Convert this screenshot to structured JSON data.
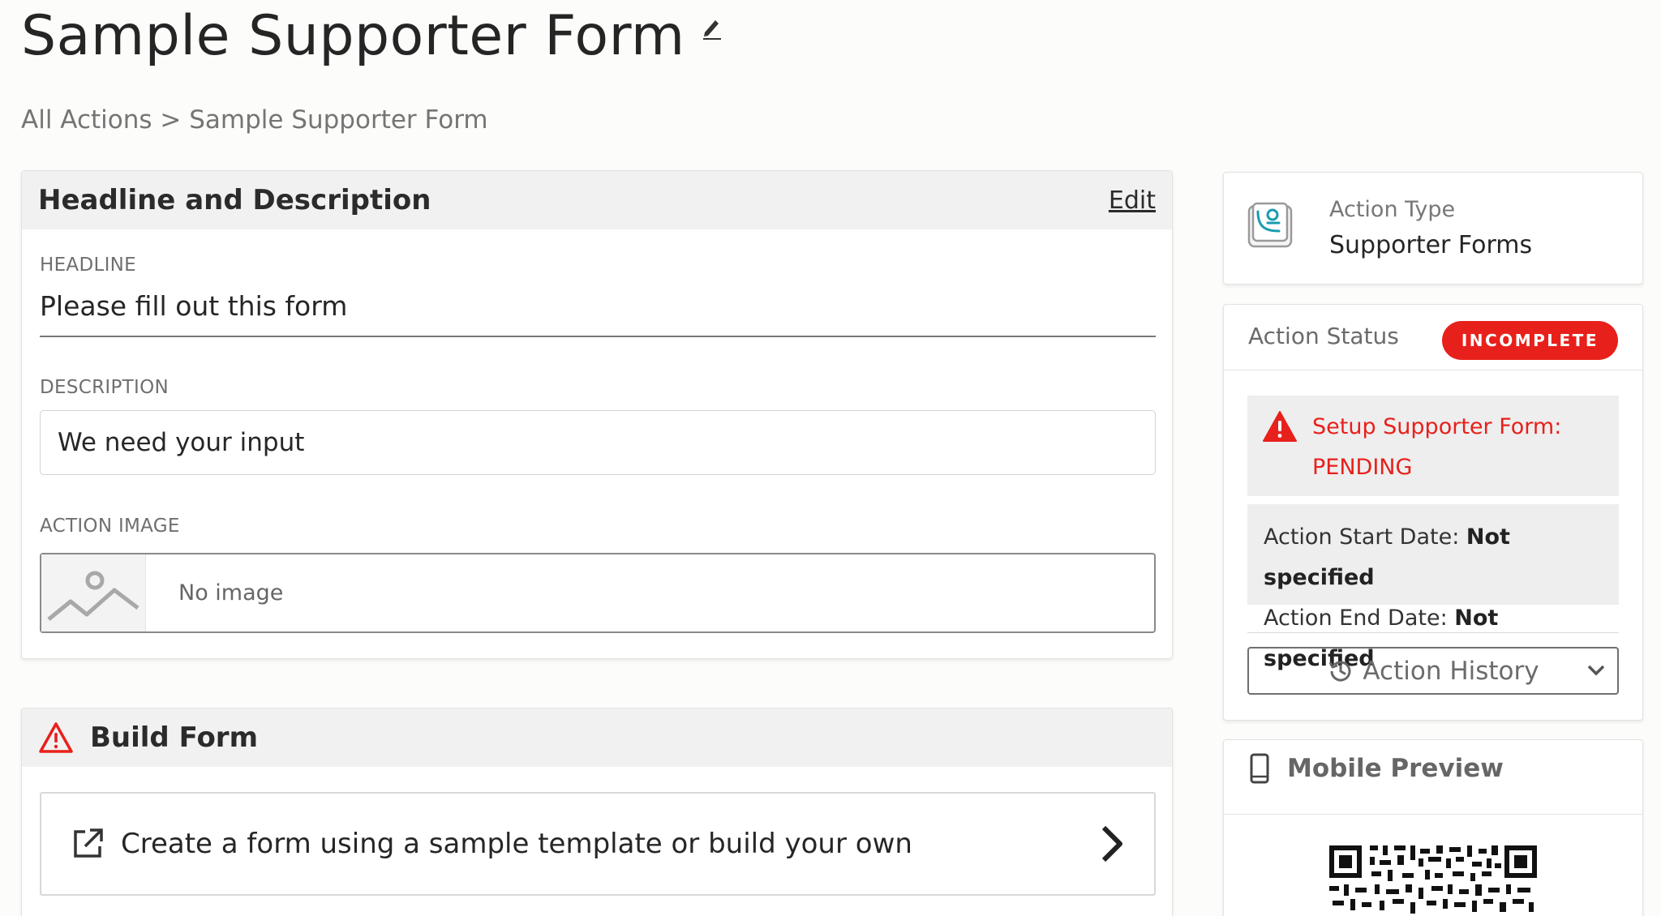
{
  "page": {
    "title": "Sample Supporter Form",
    "breadcrumb": "All Actions > Sample Supporter Form"
  },
  "headline_card": {
    "title": "Headline and Description",
    "edit_label": "Edit",
    "headline_label": "HEADLINE",
    "headline_value": "Please fill out this form",
    "description_label": "DESCRIPTION",
    "description_value": "We need your input",
    "image_label": "ACTION IMAGE",
    "image_placeholder": "No image"
  },
  "build_card": {
    "title": "Build Form",
    "item_label": "Create a form using a sample template or build your own"
  },
  "action_type": {
    "label": "Action Type",
    "value": "Supporter Forms",
    "icon": "supporter-form-icon"
  },
  "action_status": {
    "title": "Action Status",
    "badge": "INCOMPLETE",
    "pending_line1": "Setup Supporter Form:",
    "pending_line2": "PENDING",
    "start_label": "Action Start Date:",
    "start_value": "Not specified",
    "end_label": "Action End Date:",
    "end_value": "Not specified",
    "history_label": "Action History"
  },
  "mobile_preview": {
    "title": "Mobile Preview"
  },
  "colors": {
    "alert_red": "#e8201b",
    "teal_icon": "#1a9bb0",
    "header_gray": "#f1f1f1"
  }
}
